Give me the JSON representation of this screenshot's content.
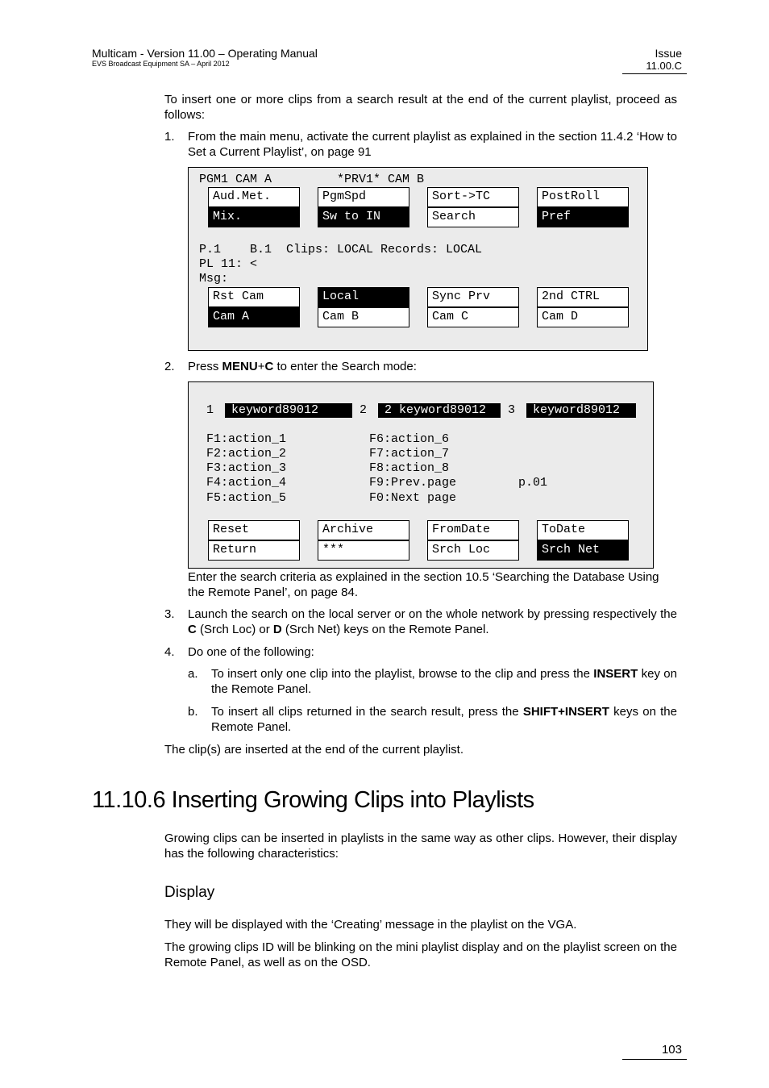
{
  "header": {
    "title": "Multicam - Version 11.00 – Operating Manual",
    "subtitle": "EVS Broadcast Equipment SA – April 2012",
    "issue_label": "Issue",
    "issue_value": "11.00.C"
  },
  "intro": "To insert one or more clips from a search result at the end of the current playlist, proceed as follows:",
  "steps": [
    {
      "num": "1.",
      "text": "From the main menu, activate the current playlist as explained in the section 11.4.2 ‘How to Set a Current Playlist’, on page 91"
    },
    {
      "num": "2.",
      "pre": "Press ",
      "bold": "MENU",
      "mid": "+",
      "bold2": "C",
      "post": "  to enter the Search mode:"
    },
    {
      "num": "3.",
      "t1": "Launch the search on the local server or on the whole network by pressing respectively the ",
      "b1": "C",
      "t2": " (Srch Loc) or ",
      "b2": "D",
      "t3": " (Srch Net) keys on the Remote Panel."
    },
    {
      "num": "4.",
      "text": "Do one of the following:"
    }
  ],
  "screen1": {
    "top_line": "PGM1 CAM A         *PRV1* CAM B",
    "keys_top": [
      {
        "label": "Aud.Met.",
        "inverted": false
      },
      {
        "label": "PgmSpd",
        "inverted": false
      },
      {
        "label": "Sort->TC",
        "inverted": false
      },
      {
        "label": "PostRoll",
        "inverted": false
      },
      {
        "label": "Mix.",
        "inverted": true
      },
      {
        "label": "Sw to IN",
        "inverted": true
      },
      {
        "label": "Search",
        "inverted": false
      },
      {
        "label": "Pref",
        "inverted": true
      }
    ],
    "status_line1": "P.1    B.1  Clips: LOCAL Records: LOCAL",
    "status_line2": "PL 11: <",
    "status_line3": "Msg:",
    "keys_bottom": [
      {
        "label": "Rst Cam",
        "inverted": false
      },
      {
        "label": "Local",
        "inverted": true
      },
      {
        "label": "Sync Prv",
        "inverted": false
      },
      {
        "label": "2nd CTRL",
        "inverted": false
      },
      {
        "label": "Cam A",
        "inverted": true
      },
      {
        "label": "Cam B",
        "inverted": false
      },
      {
        "label": "Cam C",
        "inverted": false
      },
      {
        "label": "Cam D",
        "inverted": false
      }
    ]
  },
  "screen2": {
    "kw_index1": "1",
    "kw1": "keyword89012",
    "kw_index2": "2",
    "kw2": "2 keyword89012",
    "kw_index3": "3",
    "kw3": "keyword89012",
    "actions_left": [
      "F1:action_1",
      "F2:action_2",
      "F3:action_3",
      "F4:action_4",
      "F5:action_5"
    ],
    "actions_right": [
      "F6:action_6",
      "F7:action_7",
      "F8:action_8",
      "F9:Prev.page",
      "F0:Next page"
    ],
    "page": "p.01",
    "keys": [
      {
        "label": "Reset",
        "inverted": false
      },
      {
        "label": "Archive",
        "inverted": false
      },
      {
        "label": "FromDate",
        "inverted": false
      },
      {
        "label": "ToDate",
        "inverted": false
      },
      {
        "label": "Return",
        "inverted": false
      },
      {
        "label": "***",
        "inverted": false
      },
      {
        "label": "Srch Loc",
        "inverted": false
      },
      {
        "label": "Srch Net",
        "inverted": true
      }
    ]
  },
  "after_screen2": "Enter the search criteria as explained in the section 10.5 ‘Searching the Database Using the Remote Panel’, on page 84.",
  "substeps": [
    {
      "letter": "a.",
      "t1": "To insert only one clip into the playlist, browse to the clip and press the ",
      "b1": "INSERT",
      "t2": " key on the Remote Panel."
    },
    {
      "letter": "b.",
      "t1": "To insert all clips returned in the search result, press the ",
      "b1": "SHIFT+INSERT",
      "t2": " keys on the Remote Panel."
    }
  ],
  "result": "The clip(s) are inserted at the end of the current playlist.",
  "section": {
    "heading": "11.10.6  Inserting Growing Clips into Playlists",
    "intro": "Growing clips can be inserted in playlists in the same way as other clips. However, their display has the following characteristics:",
    "subheading": "Display",
    "para1": "They will be displayed with the ‘Creating’ message in the playlist on the VGA.",
    "para2": "The growing clips ID will be blinking on the mini playlist display and on the playlist screen on the Remote Panel, as well as on the OSD."
  },
  "page_number": "103"
}
